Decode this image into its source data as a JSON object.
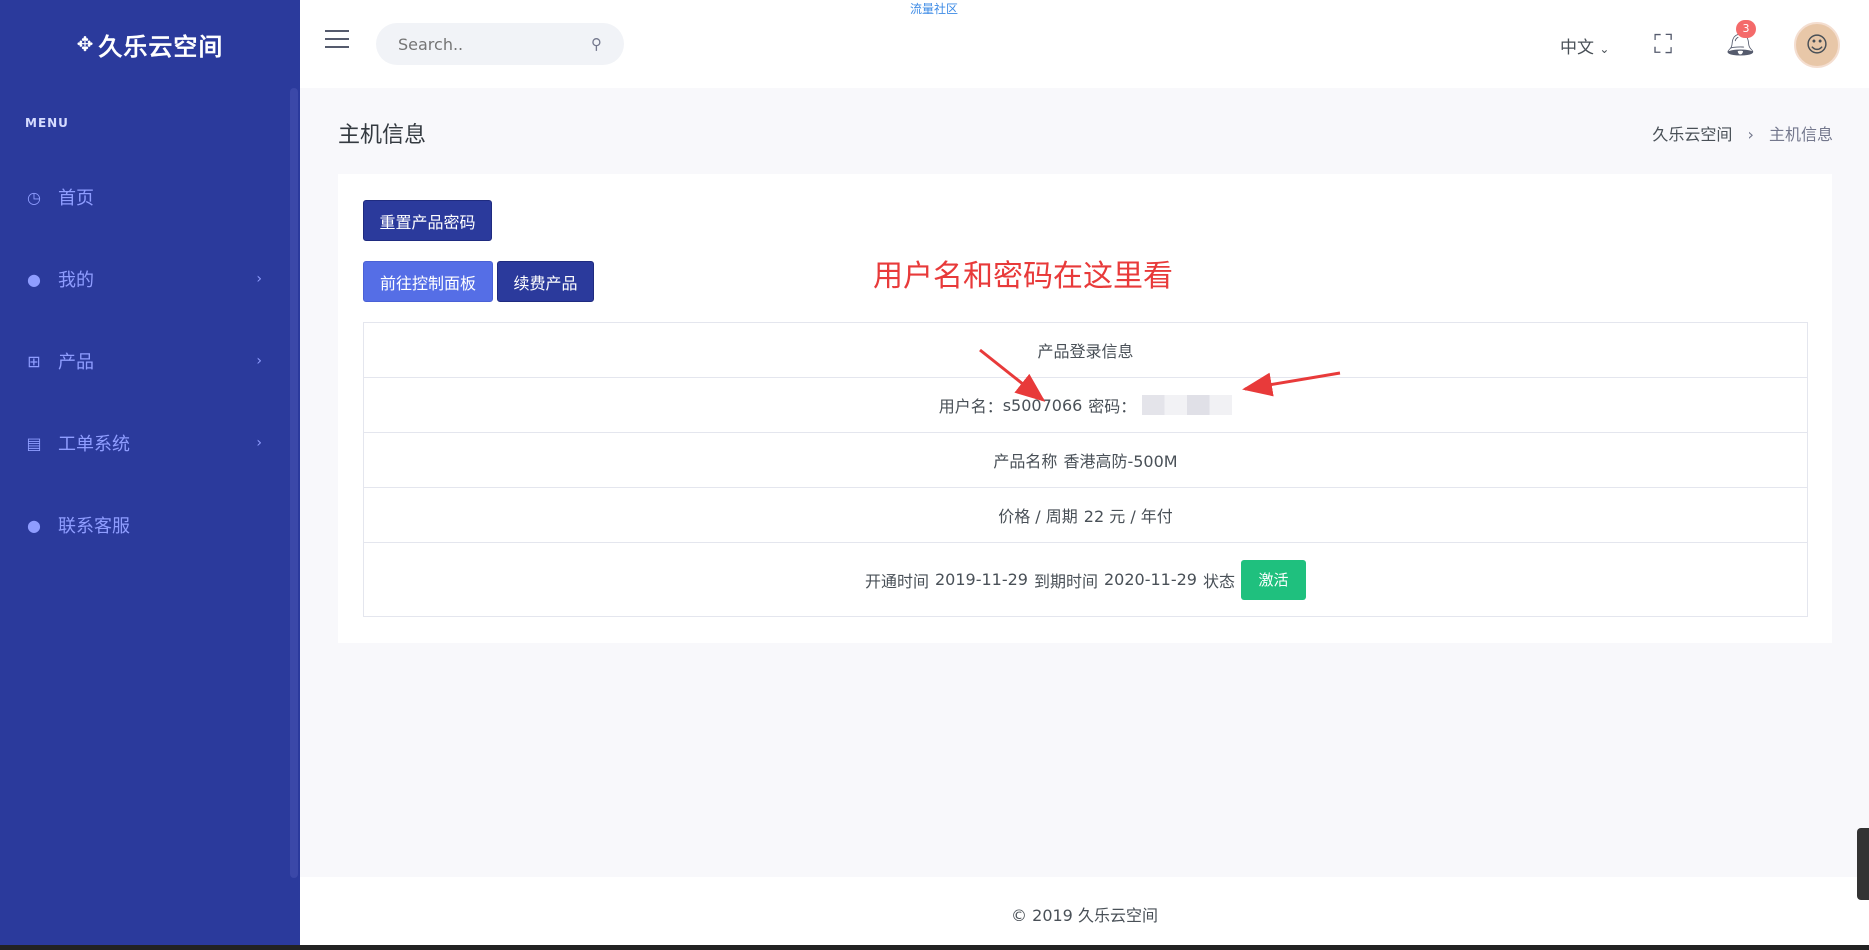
{
  "sidebar": {
    "logo": "久乐云空间",
    "menu_title": "MENU",
    "items": [
      {
        "label": "首页",
        "icon": "dashboard-icon"
      },
      {
        "label": "我的",
        "icon": "user-icon"
      },
      {
        "label": "产品",
        "icon": "grid-icon"
      },
      {
        "label": "工单系统",
        "icon": "ticket-icon"
      },
      {
        "label": "联系客服",
        "icon": "support-icon"
      }
    ]
  },
  "topbar": {
    "search_placeholder": "Search..",
    "community_link": "流量社区",
    "language": "中文",
    "notification_count": "3"
  },
  "page": {
    "title": "主机信息",
    "breadcrumb": [
      "久乐云空间",
      "主机信息"
    ]
  },
  "actions": {
    "reset_password": "重置产品密码",
    "control_panel": "前往控制面板",
    "renew": "续费产品"
  },
  "annotation": "用户名和密码在这里看",
  "info": {
    "header": "产品登录信息",
    "username_label": "用户名：",
    "username": "s5007066",
    "password_label": "密码：",
    "product_name_label": "产品名称",
    "product_name": "香港高防-500M",
    "price_label": "价格 / 周期",
    "price": "22 元 / 年付",
    "open_label": "开通时间",
    "open_date": "2019-11-29",
    "expire_label": "到期时间",
    "expire_date": "2020-11-29",
    "status_label": "状态",
    "status": "激活"
  },
  "footer": "© 2019 久乐云空间",
  "colors": {
    "sidebar_bg": "#2b3a9c",
    "primary": "#556ee6",
    "success": "#1fc07e",
    "annotation": "#e83a3a"
  }
}
